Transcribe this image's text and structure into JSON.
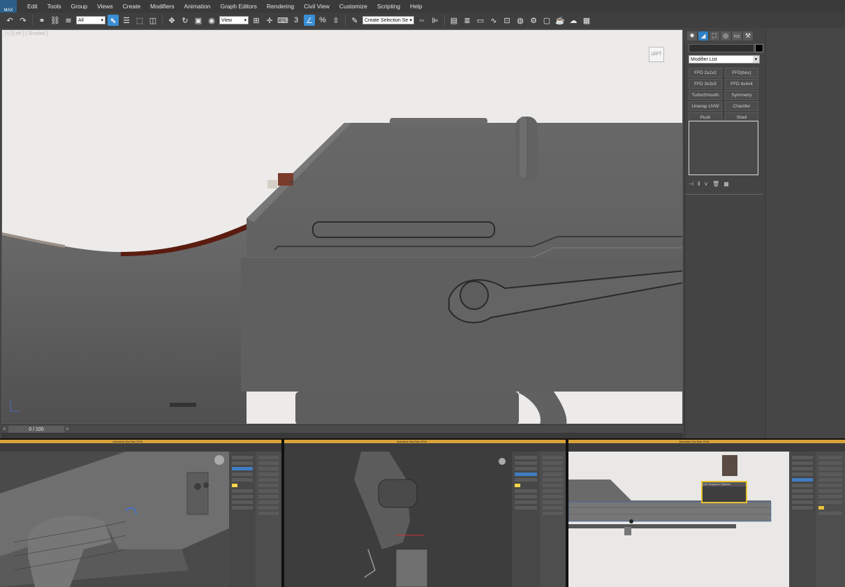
{
  "app": {
    "logo_text": "MAX"
  },
  "menu": {
    "items": [
      "Edit",
      "Tools",
      "Group",
      "Views",
      "Create",
      "Modifiers",
      "Animation",
      "Graph Editors",
      "Rendering",
      "Civil View",
      "Customize",
      "Scripting",
      "Help"
    ]
  },
  "toolbar": {
    "selection_filter": "All",
    "coordinate_system": "View",
    "named_selection_sets": "Create Selection Se",
    "snap_label": "3",
    "angle_snap_label": "",
    "percent_snap_label": "%"
  },
  "viewport": {
    "label": "[+] [Left ] [ Shaded ]",
    "viewcube_label": "LEFT"
  },
  "time_slider": {
    "prev": "<",
    "value": "0 / 100",
    "next": ">"
  },
  "command_panel": {
    "modifier_list": "Modifier List",
    "modifier_buttons": [
      "FFD 2x2x2",
      "FFD(box)",
      "FFD 3x3x3",
      "FFD 4x4x4",
      "TurboSmooth",
      "Symmetry",
      "Unwrap UVW",
      "Chamfer",
      "Push",
      "Shell"
    ],
    "stack_icons": [
      "pin-stack-icon",
      "show-end-result-icon",
      "make-unique-icon",
      "remove-modifier-icon",
      "configure-sets-icon"
    ]
  },
  "thumbnails": [
    {
      "name": "thumb-1",
      "title": "Autodesk 3ds Max 2016"
    },
    {
      "name": "thumb-2",
      "title": "Autodesk 3ds Max 2016"
    },
    {
      "name": "thumb-3",
      "title": "Autodesk 3ds Max 2016"
    }
  ],
  "thumb3_dialog": {
    "title": "Line Segment Options"
  },
  "colors": {
    "accent": "#2f7fc4",
    "title_bar": "#d8a23a",
    "ui_dark": "#444444",
    "viewport_bg": "#ecebe9",
    "model_gray": "#5e5e5e"
  }
}
